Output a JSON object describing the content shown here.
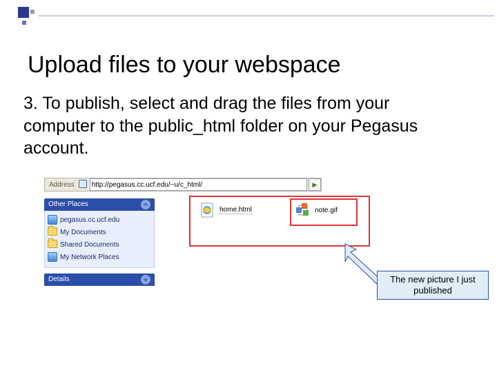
{
  "slide": {
    "title": "Upload files to your webspace",
    "body": "3. To publish, select and drag the files from your computer to the public_html folder on your Pegasus account."
  },
  "explorer": {
    "address_label": "Address",
    "url": "http://pegasus.cc.ucf.edu/~u/c_html/",
    "sidebar": {
      "other_places": "Other Places",
      "details": "Details",
      "items": [
        {
          "label": "pegasus.cc.ucf.edu"
        },
        {
          "label": "My Documents"
        },
        {
          "label": "Shared Documents"
        },
        {
          "label": "My Network Places"
        }
      ]
    },
    "files": {
      "home": "home.html",
      "note": "note.gif"
    }
  },
  "callout": {
    "text": "The new picture I just published"
  }
}
